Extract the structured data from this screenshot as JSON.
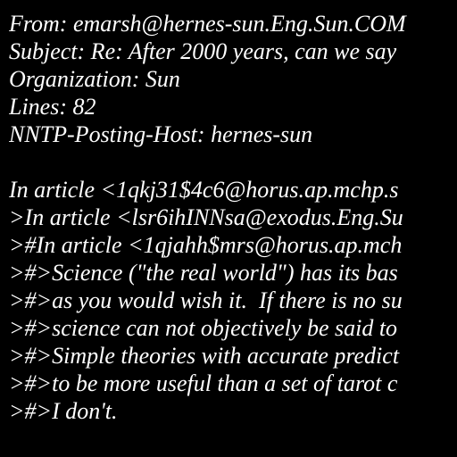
{
  "colors": {
    "background": "#000000",
    "text": "#ffffff"
  },
  "header": {
    "from": "From: emarsh@hernes-sun.Eng.Sun.COM",
    "subject": "Subject: Re: After 2000 years, can we say",
    "organization": "Organization: Sun",
    "lines": "Lines: 82",
    "posting_host": "NNTP-Posting-Host: hernes-sun"
  },
  "body": [
    "In article <1qkj31$4c6@horus.ap.mchp.s",
    ">In article <lsr6ihINNsa@exodus.Eng.Su",
    ">#In article <1qjahh$mrs@horus.ap.mch",
    ">#>Science (\"the real world\") has its bas",
    ">#>as you would wish it.  If there is no su",
    ">#>science can not objectively be said to",
    ">#>Simple theories with accurate predict",
    ">#>to be more useful than a set of tarot c",
    ">#>I don't."
  ]
}
